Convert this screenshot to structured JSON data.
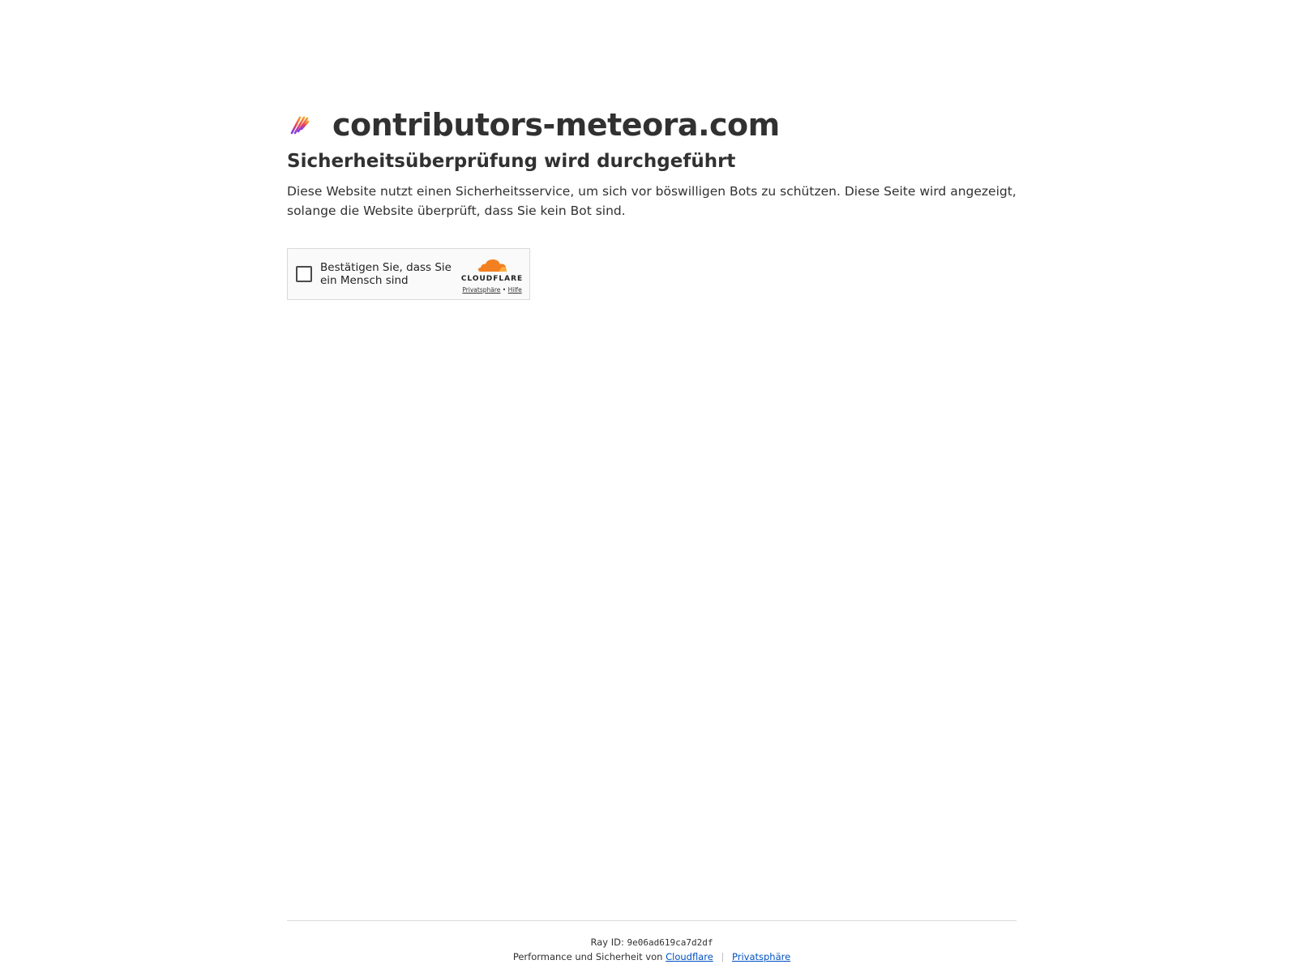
{
  "site": {
    "name": "contributors-meteora.com",
    "favicon_icon": "meteora-stripes-icon"
  },
  "challenge": {
    "headline": "Sicherheitsüberprüfung wird durchgeführt",
    "description": "Diese Website nutzt einen Sicherheitsservice, um sich vor böswilligen Bots zu schützen. Diese Seite wird angezeigt, solange die Website überprüft, dass Sie kein Bot sind."
  },
  "turnstile": {
    "label": "Bestätigen Sie, dass Sie ein Mensch sind",
    "brand": "CLOUDFLARE",
    "privacy_link": "Privatsphäre",
    "link_separator": "•",
    "help_link": "Hilfe",
    "checked": false
  },
  "footer": {
    "ray_label": "Ray ID:",
    "ray_id": "9e06ad619ca7d2df",
    "performance_text": "Performance und Sicherheit von",
    "cloudflare_link": "Cloudflare",
    "separator": "|",
    "privacy_link": "Privatsphäre"
  },
  "colors": {
    "text": "#313131",
    "link": "#0051c3",
    "cloudflare_orange": "#f38020",
    "cloudflare_light_orange": "#faae40"
  }
}
